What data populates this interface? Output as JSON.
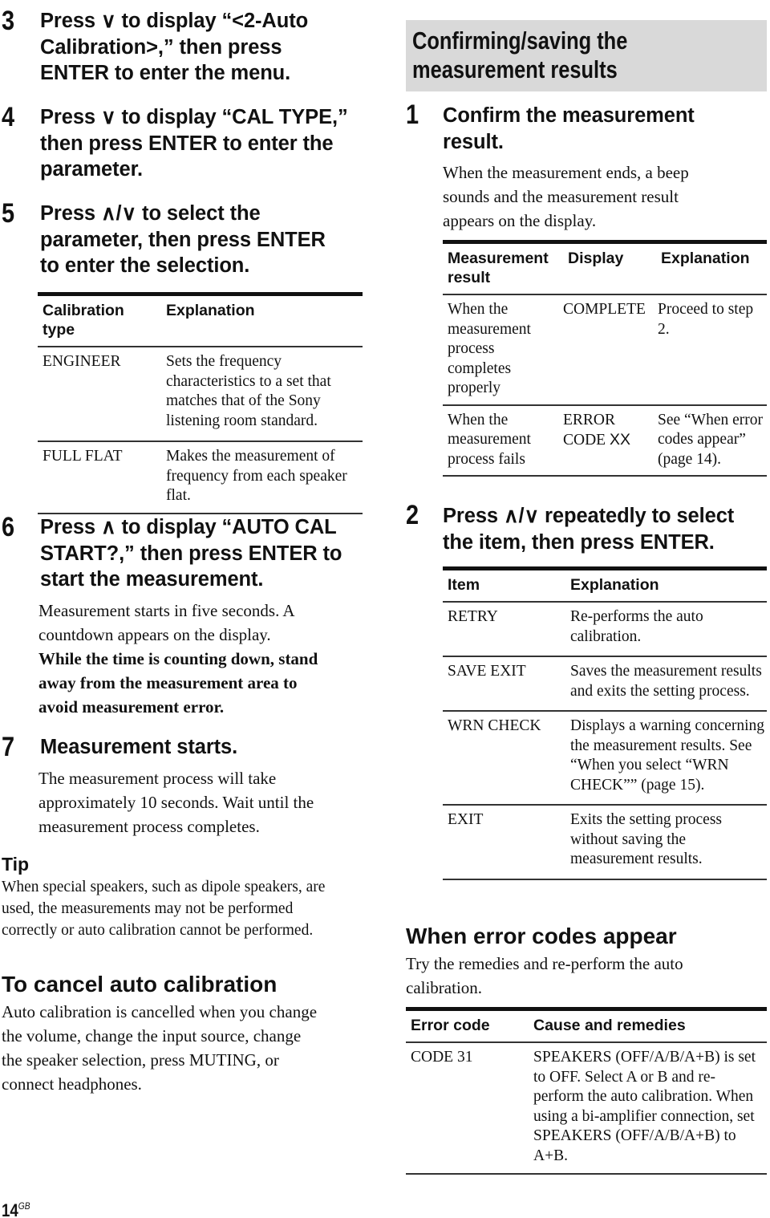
{
  "left": {
    "steps": [
      {
        "number": "3",
        "lines": [
          "Press ∨ to display “<2-Auto",
          "Calibration>,” then press",
          "ENTER to enter the menu."
        ]
      },
      {
        "number": "4",
        "lines": [
          "Press ∨ to display “CAL TYPE,”",
          "then press ENTER to enter the",
          "parameter."
        ]
      },
      {
        "number": "5",
        "lines": [
          "Press ∧/∨ to select the",
          "parameter, then press ENTER",
          "to enter the selection."
        ]
      },
      {
        "number": "6",
        "lines": [
          "Press ∧ to display “AUTO CAL",
          "START?,” then press ENTER to",
          "start the measurement."
        ],
        "body": [
          "Measurement starts in five seconds. A",
          "countdown appears on the display."
        ],
        "bold_body": [
          "While the time is counting down, stand",
          "away from the measurement area to",
          "avoid measurement error."
        ]
      },
      {
        "number": "7",
        "lines": [
          "Measurement starts."
        ],
        "body": [
          "The measurement process will take",
          "approximately 10 seconds. Wait until the",
          "measurement process completes."
        ]
      }
    ],
    "calibration_table": {
      "headers": [
        "Calibration\ntype",
        "Explanation"
      ],
      "rows": [
        {
          "type": "ENGINEER",
          "explanation": "Sets the frequency characteristics to a set that matches that of the Sony listening room standard."
        },
        {
          "type": "FULL FLAT",
          "explanation": "Makes the measurement of frequency from each speaker flat."
        }
      ]
    },
    "tip": {
      "heading": "Tip",
      "lines": [
        "When special speakers, such as dipole speakers, are",
        "used, the measurements may not be performed",
        "correctly or auto calibration cannot be performed."
      ]
    },
    "cancel": {
      "heading": "To cancel auto calibration",
      "lines": [
        "Auto calibration is cancelled when you change",
        "the volume, change the input source, change",
        "the speaker selection, press MUTING, or",
        "connect headphones."
      ]
    }
  },
  "right": {
    "banner_lines": [
      "Confirming/saving the",
      "measurement results"
    ],
    "steps": [
      {
        "number": "1",
        "lines": [
          "Confirm the measurement",
          "result."
        ],
        "body": [
          "When the measurement ends, a beep",
          "sounds and the measurement result",
          "appears on the display."
        ]
      },
      {
        "number": "2",
        "lines": [
          "Press ∧/∨ repeatedly to select",
          "the item, then press ENTER."
        ]
      }
    ],
    "result_table": {
      "headers": [
        "Measurement result",
        "Display",
        "Explanation"
      ],
      "rows": [
        {
          "result": "When the measurement process completes properly",
          "display": "COMPLETE",
          "explanation": "Proceed to step 2."
        },
        {
          "result": "When the measurement process fails",
          "display_line1": "ERROR",
          "display_line2": "CODE ",
          "display_var": "XX",
          "explanation": "See “When error codes appear” (page 14)."
        }
      ]
    },
    "item_table": {
      "headers": [
        "Item",
        "Explanation"
      ],
      "rows": [
        {
          "item": "RETRY",
          "explanation": "Re-performs the auto calibration."
        },
        {
          "item": "SAVE EXIT",
          "explanation": "Saves the measurement results and exits the setting process."
        },
        {
          "item": "WRN CHECK",
          "explanation": "Displays a warning concerning the measurement results. See “When you select “WRN CHECK”” (page 15)."
        },
        {
          "item": "EXIT",
          "explanation": "Exits the setting process without saving the measurement results."
        }
      ]
    },
    "errors": {
      "heading": "When error codes appear",
      "intro": [
        "Try the remedies and re-perform the auto",
        "calibration."
      ],
      "headers": [
        "Error code",
        "Cause and remedies"
      ],
      "rows": [
        {
          "code": "CODE 31",
          "remedy": "SPEAKERS (OFF/A/B/A+B) is set to OFF. Select A or B and re-perform the auto calibration. When using a bi-amplifier connection, set SPEAKERS (OFF/A/B/A+B) to A+B."
        }
      ]
    }
  },
  "footer": {
    "page_number": "14",
    "page_suffix": "GB"
  }
}
